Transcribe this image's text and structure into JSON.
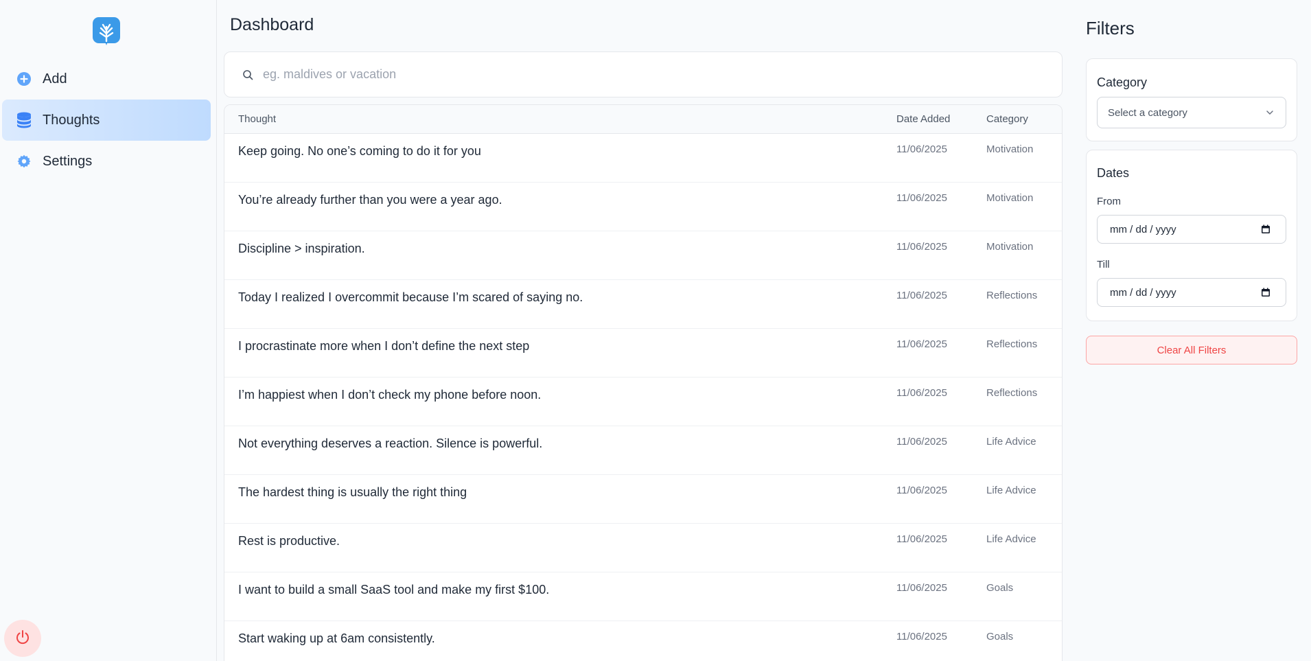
{
  "sidebar": {
    "logo": "tree-logo-icon",
    "items": [
      {
        "label": "Add",
        "icon": "plus-circle-icon",
        "active": false
      },
      {
        "label": "Thoughts",
        "icon": "database-icon",
        "active": true
      },
      {
        "label": "Settings",
        "icon": "gear-icon",
        "active": false
      }
    ],
    "power_icon": "power-icon"
  },
  "main": {
    "title": "Dashboard",
    "search": {
      "placeholder": "eg. maldives or vacation",
      "value": ""
    },
    "table": {
      "columns": [
        "Thought",
        "Date Added",
        "Category"
      ],
      "rows": [
        {
          "thought": "Keep going. No one’s coming to do it for you",
          "date": "11/06/2025",
          "category": "Motivation"
        },
        {
          "thought": "You’re already further than you were a year ago.",
          "date": "11/06/2025",
          "category": "Motivation"
        },
        {
          "thought": "Discipline > inspiration.",
          "date": "11/06/2025",
          "category": "Motivation"
        },
        {
          "thought": "Today I realized I overcommit because I’m scared of saying no.",
          "date": "11/06/2025",
          "category": "Reflections"
        },
        {
          "thought": "I procrastinate more when I don’t define the next step",
          "date": "11/06/2025",
          "category": "Reflections"
        },
        {
          "thought": "I’m happiest when I don’t check my phone before noon.",
          "date": "11/06/2025",
          "category": "Reflections"
        },
        {
          "thought": "Not everything deserves a reaction. Silence is powerful.",
          "date": "11/06/2025",
          "category": "Life Advice"
        },
        {
          "thought": "The hardest thing is usually the right thing",
          "date": "11/06/2025",
          "category": "Life Advice"
        },
        {
          "thought": "Rest is productive.",
          "date": "11/06/2025",
          "category": "Life Advice"
        },
        {
          "thought": "I want to build a small SaaS tool and make my first $100.",
          "date": "11/06/2025",
          "category": "Goals"
        },
        {
          "thought": "Start waking up at 6am consistently.",
          "date": "11/06/2025",
          "category": "Goals"
        }
      ]
    }
  },
  "filters": {
    "title": "Filters",
    "category": {
      "label": "Category",
      "placeholder": "Select a category"
    },
    "dates": {
      "label": "Dates",
      "from_label": "From",
      "from_value": "mm / dd / yyyy",
      "till_label": "Till",
      "till_value": "mm / dd / yyyy"
    },
    "clear_label": "Clear All Filters"
  },
  "colors": {
    "accent": "#3b82f6",
    "active_nav_bg": "#bfdbfe",
    "danger": "#ef4444",
    "danger_bg": "#fef2f2"
  }
}
